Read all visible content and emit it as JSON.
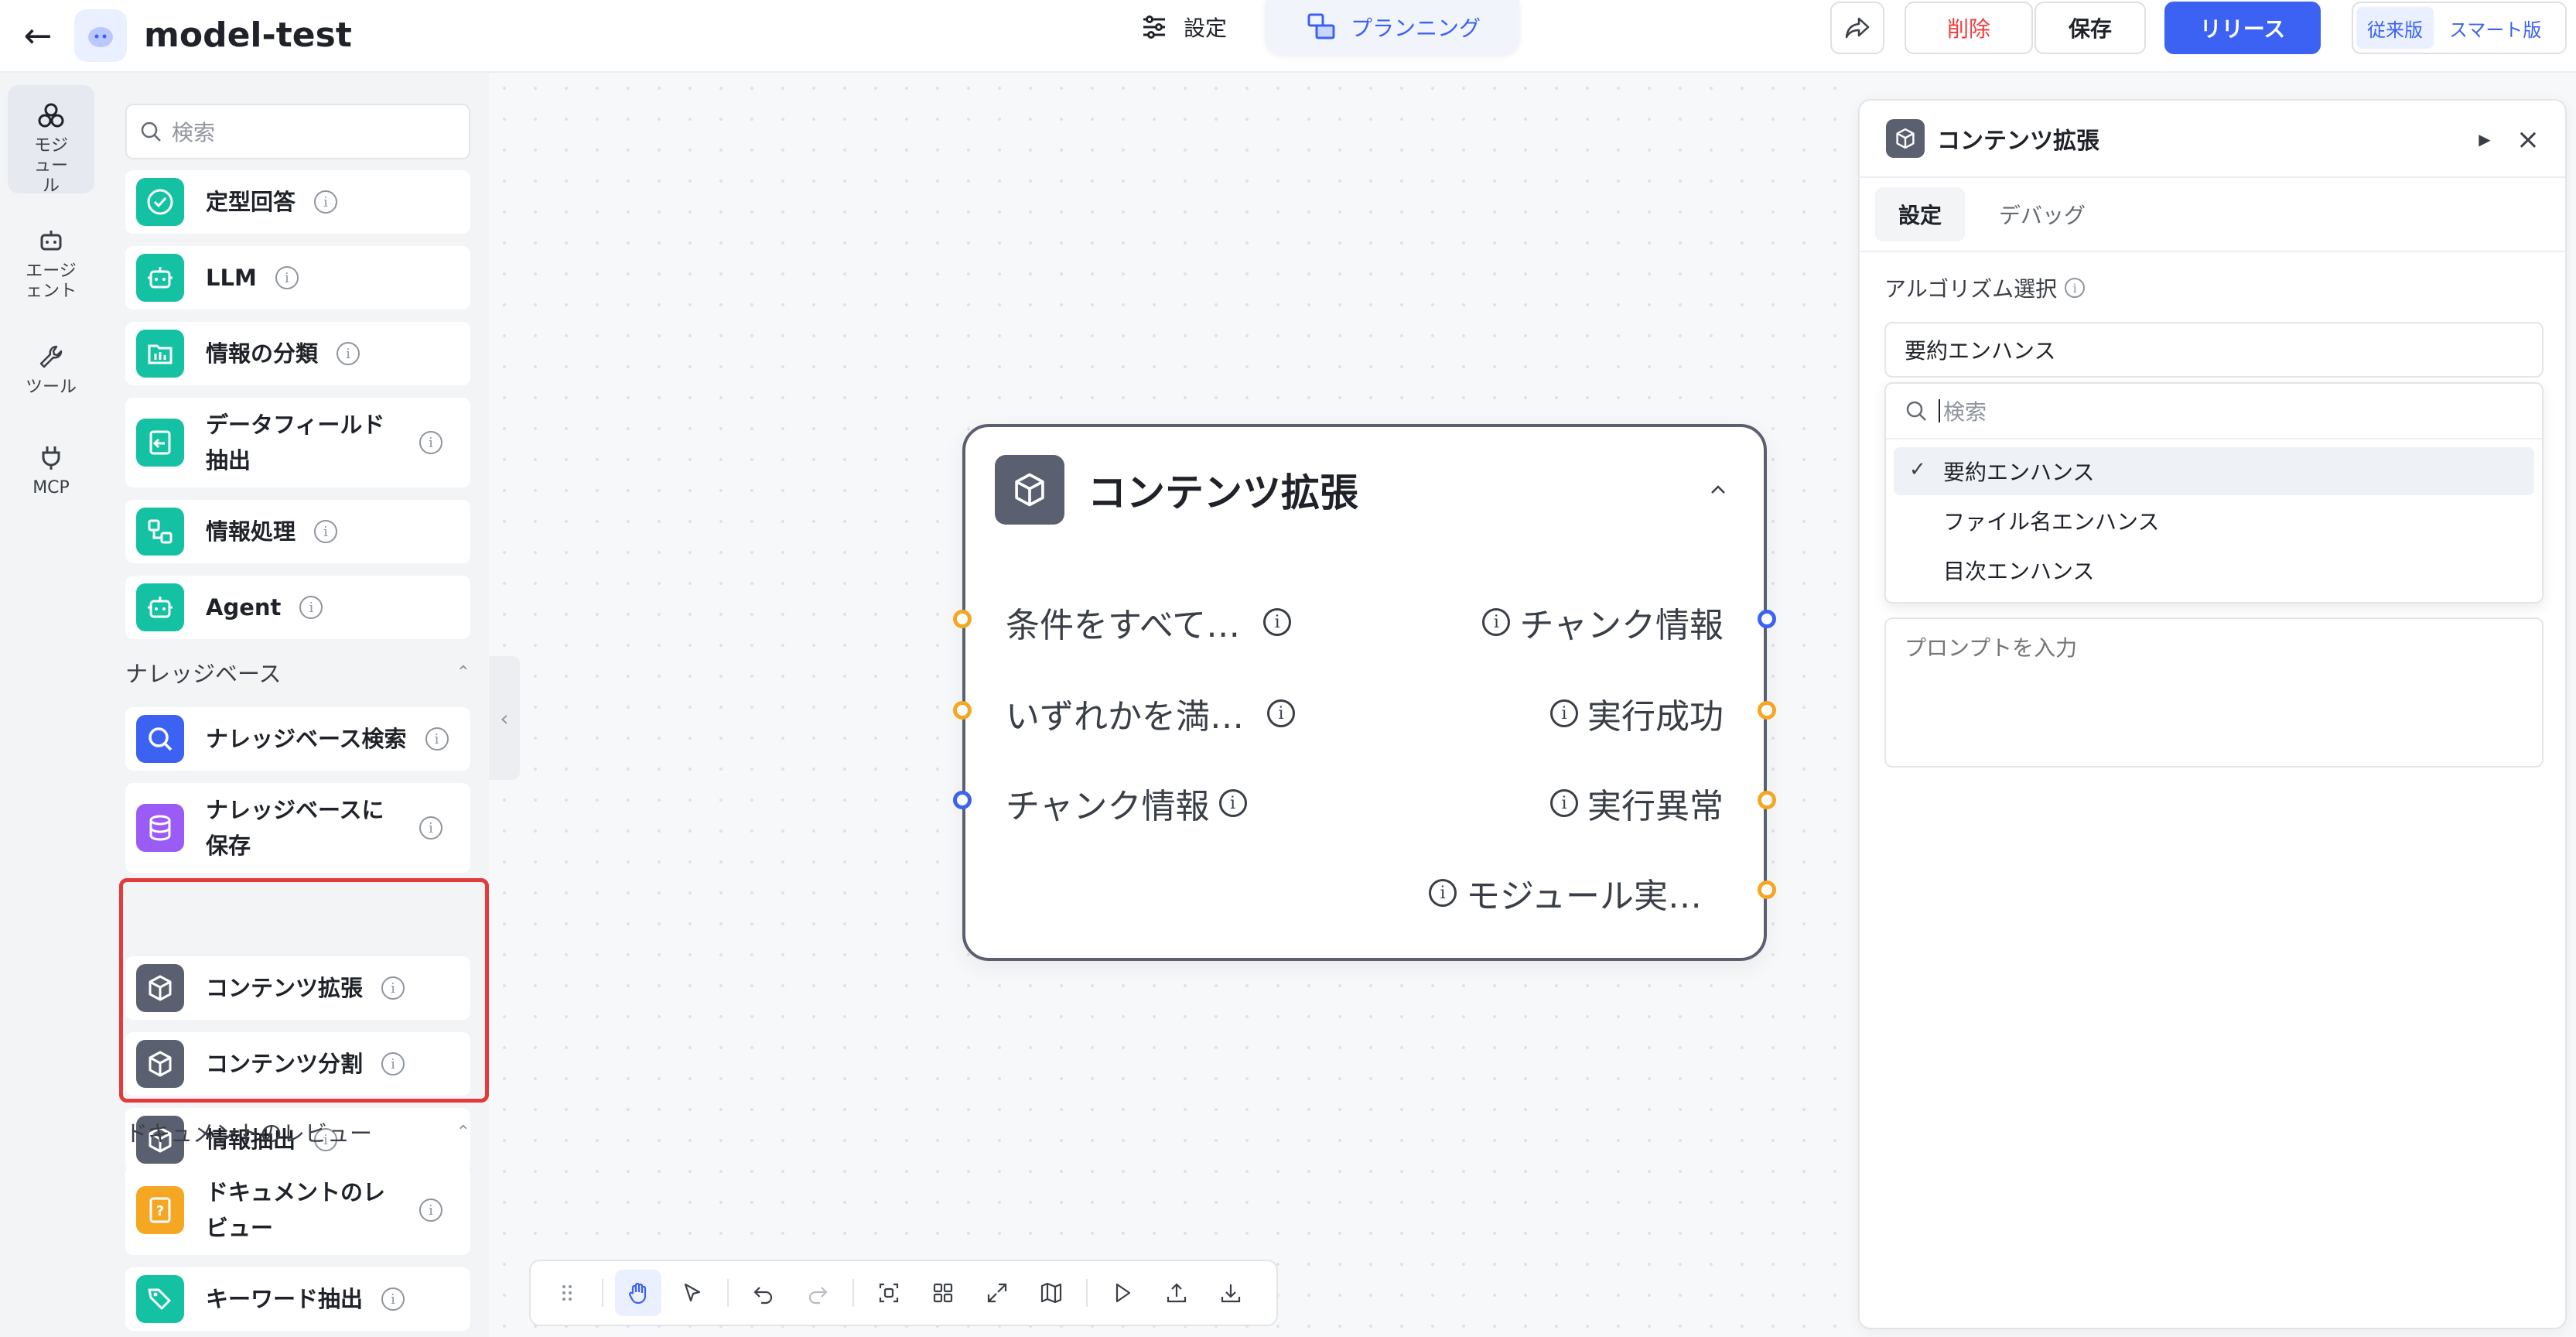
{
  "header": {
    "back_icon": "arrow-left-icon",
    "app_title": "model-test",
    "modes": [
      {
        "label": "設定",
        "icon": "sliders-icon",
        "active": false
      },
      {
        "label": "プランニング",
        "icon": "workflow-icon",
        "active": true
      }
    ],
    "share_icon": "share-icon",
    "delete_label": "削除",
    "save_label": "保存",
    "release_label": "リリース",
    "version_options": [
      "従来版",
      "スマート版"
    ],
    "version_active": "従来版",
    "colors": {
      "accent": "#3b62f2",
      "danger": "#f23c3c"
    }
  },
  "rail": {
    "items": [
      {
        "label": "モジュール",
        "icon": "modules-icon",
        "active": true
      },
      {
        "label": "エージェント",
        "icon": "robot-icon",
        "active": false
      },
      {
        "label": "ツール",
        "icon": "wrench-icon",
        "active": false
      },
      {
        "label": "MCP",
        "icon": "plug-icon",
        "active": false
      }
    ]
  },
  "module_panel": {
    "search_placeholder": "検索",
    "items": [
      {
        "label": "定型回答",
        "icon": "check-circle-icon",
        "color": "#14c2a3"
      },
      {
        "label": "LLM",
        "icon": "robot-icon",
        "color": "#14c2a3"
      },
      {
        "label": "情報の分類",
        "icon": "classify-icon",
        "color": "#14c2a3"
      },
      {
        "label": "データフィールド抽出",
        "icon": "extract-field-icon",
        "color": "#14c2a3"
      },
      {
        "label": "情報処理",
        "icon": "process-icon",
        "color": "#14c2a3"
      },
      {
        "label": "Agent",
        "icon": "robot-icon",
        "color": "#14c2a3"
      }
    ],
    "sections": [
      {
        "title": "ナレッジベース",
        "items": [
          {
            "label": "ナレッジベース検索",
            "icon": "search-icon",
            "color": "#3b62f2"
          },
          {
            "label": "ナレッジベースに保存",
            "icon": "database-icon",
            "color": "#9b5cf6"
          },
          {
            "label": "コンテンツ拡張",
            "icon": "cube-icon",
            "color": "#5a6070"
          },
          {
            "label": "コンテンツ分割",
            "icon": "cube-icon",
            "color": "#5a6070"
          },
          {
            "label": "情報抽出",
            "icon": "cube-icon",
            "color": "#5a6070"
          }
        ]
      },
      {
        "title": "ドキュメントのレビュー",
        "items": [
          {
            "label": "ドキュメントのレビュー",
            "icon": "document-question-icon",
            "color": "#f5a623"
          },
          {
            "label": "キーワード抽出",
            "icon": "tags-icon",
            "color": "#14c2a3"
          }
        ]
      }
    ]
  },
  "node": {
    "title": "コンテンツ拡張",
    "icon": "cube-icon",
    "inputs": [
      {
        "label": "条件をすべて…",
        "port": "orange"
      },
      {
        "label": "いずれかを満…",
        "port": "orange"
      },
      {
        "label": "チャンク情報",
        "port": "blue"
      }
    ],
    "outputs": [
      {
        "label": "チャンク情報",
        "port": "blue"
      },
      {
        "label": "実行成功",
        "port": "orange"
      },
      {
        "label": "実行異常",
        "port": "orange"
      },
      {
        "label": "モジュール実…",
        "port": "orange"
      }
    ]
  },
  "toolbar": {
    "buttons": [
      "drag-handle-icon",
      "hand-icon",
      "pointer-icon",
      "undo-icon",
      "redo-icon",
      "focus-icon",
      "grid-icon",
      "expand-icon",
      "map-icon",
      "play-icon",
      "upload-icon",
      "download-icon"
    ],
    "active": "hand-icon"
  },
  "settings_panel": {
    "title": "コンテンツ拡張",
    "tabs": [
      {
        "label": "設定",
        "active": true
      },
      {
        "label": "デバッグ",
        "active": false
      }
    ],
    "algorithm_label": "アルゴリズム選択",
    "algorithm_value": "要約エンハンス",
    "dropdown_search_placeholder": "検索",
    "options": [
      {
        "label": "要約エンハンス",
        "selected": true
      },
      {
        "label": "ファイル名エンハンス",
        "selected": false
      },
      {
        "label": "目次エンハンス",
        "selected": false
      }
    ],
    "prompt_placeholder": "プロンプトを入力"
  }
}
